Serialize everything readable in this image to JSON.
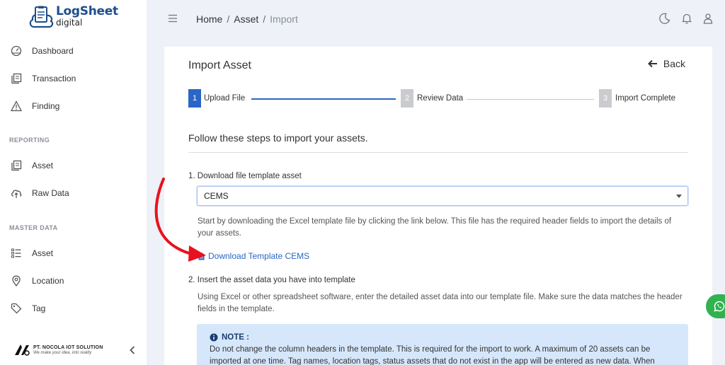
{
  "brand": {
    "title": "LogSheet",
    "subtitle": "digital"
  },
  "sidebar": {
    "items": [
      {
        "label": "Dashboard",
        "icon": "dashboard-gauge-icon"
      },
      {
        "label": "Transaction",
        "icon": "transaction-copy-icon"
      },
      {
        "label": "Finding",
        "icon": "warning-triangle-icon"
      }
    ],
    "reporting_label": "REPORTING",
    "reporting_items": [
      {
        "label": "Asset",
        "icon": "asset-copy-icon"
      },
      {
        "label": "Raw Data",
        "icon": "cloud-upload-icon"
      }
    ],
    "master_label": "MASTER DATA",
    "master_items": [
      {
        "label": "Asset",
        "icon": "list-icon"
      },
      {
        "label": "Location",
        "icon": "map-pin-icon"
      },
      {
        "label": "Tag",
        "icon": "tag-icon"
      }
    ],
    "company_name": "PT. NOCOLA IOT SOLUTION",
    "company_tagline": "We make your idea, into reality"
  },
  "topbar": {
    "breadcrumb": [
      "Home",
      "Asset",
      "Import"
    ],
    "separator": "/"
  },
  "page": {
    "title": "Import Asset",
    "back_label": "Back",
    "steps": [
      {
        "num": "1",
        "label": "Upload File",
        "active": true
      },
      {
        "num": "2",
        "label": "Review Data",
        "active": false
      },
      {
        "num": "3",
        "label": "Import Complete",
        "active": false
      }
    ],
    "heading": "Follow these steps to import your assets.",
    "step1_title": "1. Download file template asset",
    "template_select_value": "CEMS",
    "step1_desc": "Start by downloading the Excel template file by clicking the link below. This file has the required header fields to import the details of your assets.",
    "download_link": "Download Template CEMS",
    "step2_title": "2. Insert the asset data you have into template",
    "step2_desc": "Using Excel or other spreadsheet software, enter the detailed asset data into our template file. Make sure the data matches the header fields in the template.",
    "note_title": "NOTE :",
    "note_body": "Do not change the column headers in the template. This is required for the import to work. A maximum of 20 assets can be imported at one time. Tag names, location tags, status assets that do not exist in the app will be entered as new data. When"
  },
  "colors": {
    "accent": "#2a66c5",
    "brand_dark": "#1f4e8c",
    "note_bg": "#d6e7fb",
    "arrow": "#e8121e",
    "whatsapp": "#2fb24f"
  }
}
